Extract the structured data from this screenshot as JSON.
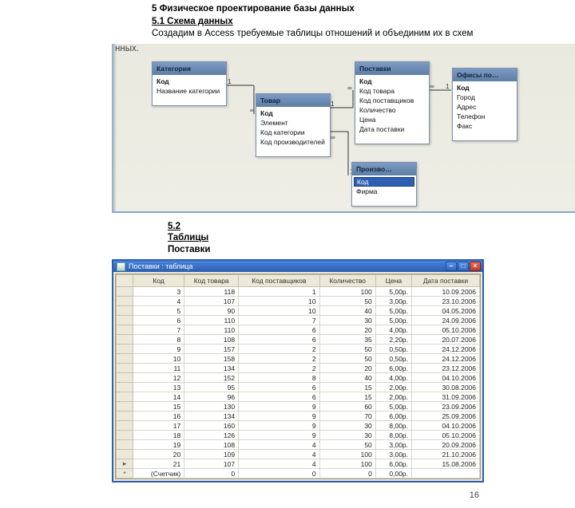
{
  "heading1": "5 Физическое проектирование базы данных",
  "heading2": "5.1 Схема данных",
  "intro": "Создадим в Access требуемые таблицы отношений и объединим их в схем",
  "intro_tail": "нных.",
  "schema_tables": {
    "kategorii": {
      "title": "Категория",
      "fields": [
        "Код",
        "Название категории"
      ]
    },
    "tovar": {
      "title": "Товар",
      "fields": [
        "Код",
        "Элемент",
        "Код категории",
        "Код производителей"
      ]
    },
    "postavki": {
      "title": "Поставки",
      "fields": [
        "Код",
        "Код товара",
        "Код поставщиков",
        "Количество",
        "Цена",
        "Дата поставки"
      ]
    },
    "ofisy": {
      "title": "Офисы по…",
      "fields": [
        "Код",
        "Город",
        "Адрес",
        "Телефон",
        "Факс"
      ]
    },
    "proizvod": {
      "title": "Произво…",
      "fields": [
        "Код",
        "Фирма"
      ]
    }
  },
  "sub52_num": "5.2",
  "sub52_lbl": "Таблицы",
  "sub52_name": "Поставки",
  "window_title": "Поставки : таблица",
  "columns": [
    "Код",
    "Код товара",
    "Код поставщиков",
    "Количество",
    "Цена",
    "Дата поставки"
  ],
  "rows": [
    [
      3,
      118,
      1,
      100,
      "5,00р.",
      "10.09.2006"
    ],
    [
      4,
      107,
      10,
      50,
      "3,00р.",
      "23.10.2006"
    ],
    [
      5,
      90,
      10,
      40,
      "5,00р.",
      "04.05.2006"
    ],
    [
      6,
      110,
      7,
      30,
      "5,00р.",
      "24.09.2006"
    ],
    [
      7,
      110,
      6,
      20,
      "4,00р.",
      "05.10.2006"
    ],
    [
      8,
      108,
      6,
      35,
      "2,20р.",
      "20.07.2006"
    ],
    [
      9,
      157,
      2,
      50,
      "0,50р.",
      "24.12.2006"
    ],
    [
      10,
      158,
      2,
      50,
      "0,50р.",
      "24.12.2006"
    ],
    [
      11,
      134,
      2,
      20,
      "6,00р.",
      "23.12.2006"
    ],
    [
      12,
      152,
      8,
      40,
      "4,00р.",
      "04.10.2006"
    ],
    [
      13,
      95,
      6,
      15,
      "2,00р.",
      "30.08.2006"
    ],
    [
      14,
      96,
      6,
      15,
      "2,00р.",
      "31.09.2006"
    ],
    [
      15,
      130,
      9,
      60,
      "5,00р.",
      "23.09.2006"
    ],
    [
      16,
      134,
      9,
      70,
      "6,00р.",
      "25.09.2006"
    ],
    [
      17,
      160,
      9,
      30,
      "8,00р.",
      "04.10.2006"
    ],
    [
      18,
      126,
      9,
      30,
      "8,00р.",
      "05.10.2006"
    ],
    [
      19,
      108,
      4,
      50,
      "3,00р.",
      "20.09.2006"
    ],
    [
      20,
      109,
      4,
      100,
      "3,00р.",
      "21.10.2006"
    ],
    [
      21,
      107,
      4,
      100,
      "6,00р.",
      "15.08.2006"
    ]
  ],
  "new_row_label": "(Счетчик)",
  "page_number": "16"
}
